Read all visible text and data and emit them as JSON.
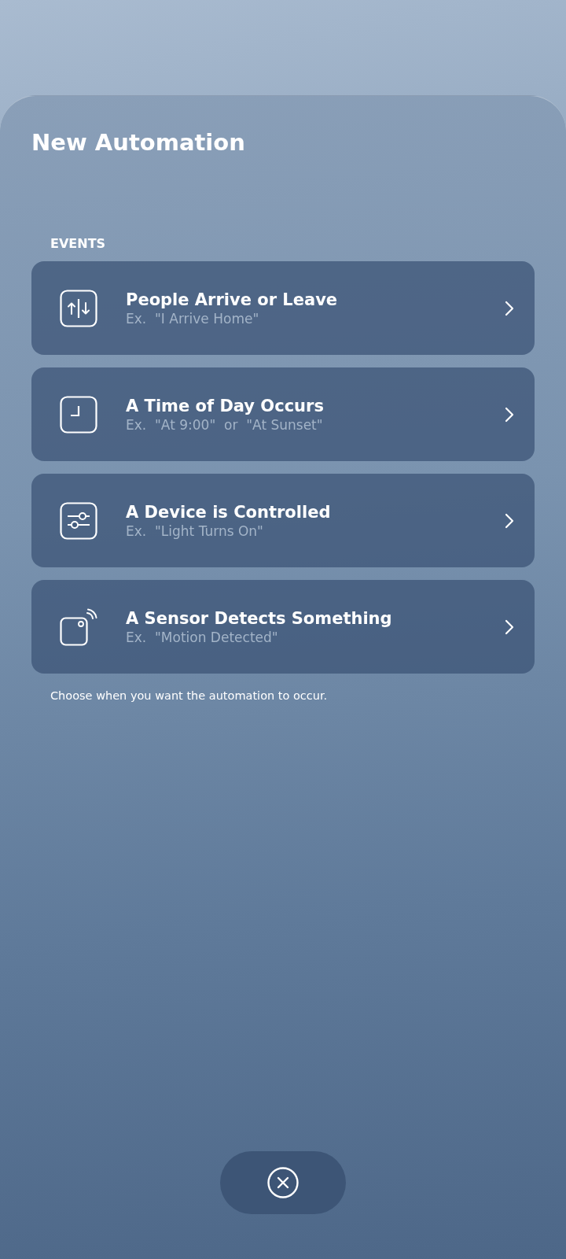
{
  "title": "New Automation",
  "section": {
    "label": "EVENTS",
    "items": [
      {
        "kind": "people",
        "title": "People Arrive or Leave",
        "example": "Ex.  \"I Arrive Home\""
      },
      {
        "kind": "time",
        "title": "A Time of Day Occurs",
        "example": "Ex.  \"At 9:00\"  or  \"At Sunset\""
      },
      {
        "kind": "device",
        "title": "A Device is Controlled",
        "example": "Ex.  \"Light Turns On\""
      },
      {
        "kind": "sensor",
        "title": "A Sensor Detects Something",
        "example": "Ex.  \"Motion Detected\""
      }
    ],
    "footer": "Choose when you want the automation to occur."
  }
}
